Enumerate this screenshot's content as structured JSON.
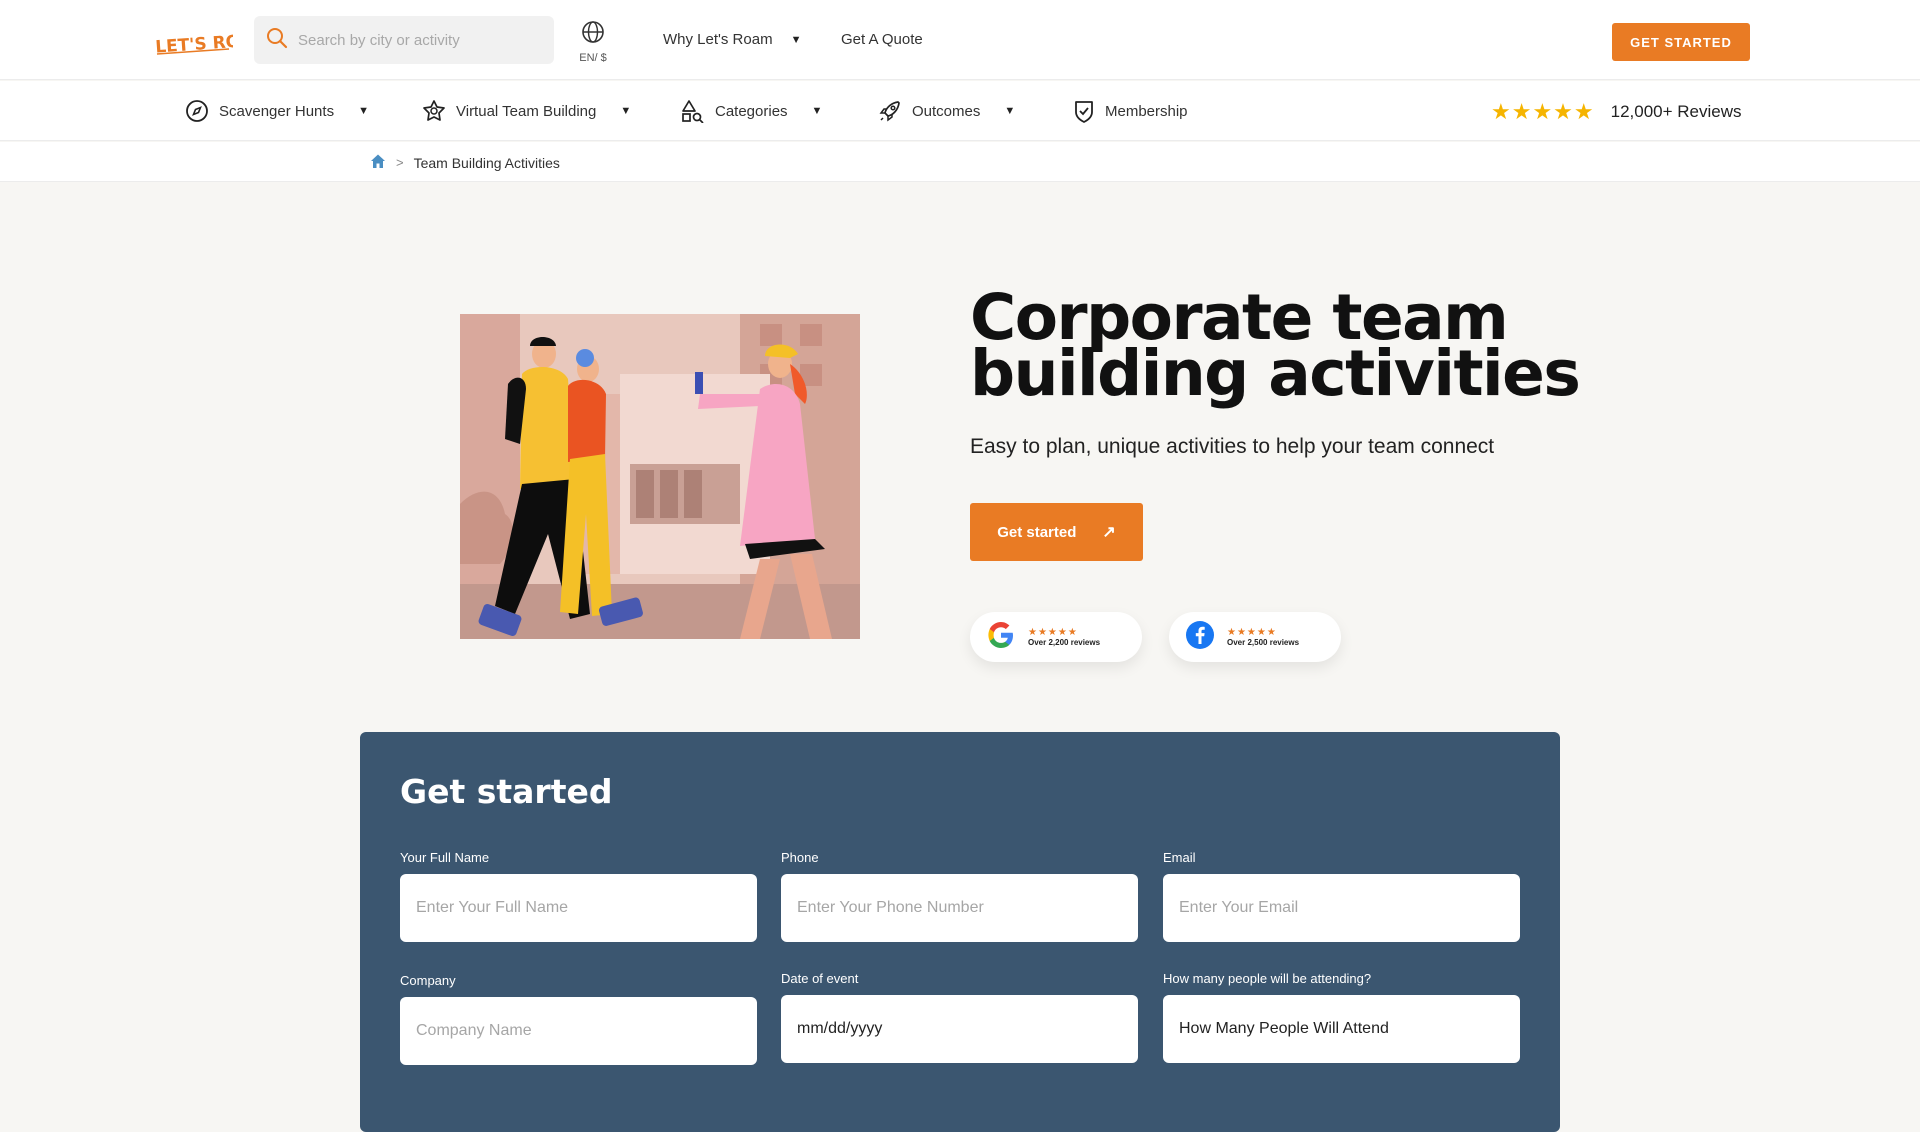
{
  "header": {
    "logo_text": "LET'S ROAM",
    "search_placeholder": "Search by city or activity",
    "lang_label": "EN/ $",
    "why_label": "Why Let's Roam",
    "quote_label": "Get A Quote",
    "cta_label": "GET STARTED"
  },
  "nav": {
    "items": [
      {
        "label": "Scavenger Hunts"
      },
      {
        "label": "Virtual Team Building"
      },
      {
        "label": "Categories"
      },
      {
        "label": "Outcomes"
      },
      {
        "label": "Membership"
      }
    ],
    "reviews_label": "12,000+ Reviews",
    "rating_stars": 5
  },
  "breadcrumb": {
    "current": "Team Building Activities"
  },
  "hero": {
    "title_line1": "Corporate team",
    "title_line2": "building activities",
    "subtitle": "Easy to plan, unique activities to help your team connect",
    "cta_label": "Get started",
    "badges": [
      {
        "source": "Google",
        "stars": "★★★★★",
        "reviews": "Over 2,200 reviews"
      },
      {
        "source": "Facebook",
        "stars": "★★★★★",
        "reviews": "Over 2,500 reviews"
      }
    ]
  },
  "form": {
    "title": "Get started",
    "fields": [
      {
        "label": "Your Full Name",
        "placeholder": "Enter Your Full Name"
      },
      {
        "label": "Phone",
        "placeholder": "Enter Your Phone Number"
      },
      {
        "label": "Email",
        "placeholder": "Enter Your Email"
      },
      {
        "label": "Company",
        "placeholder": "Company Name"
      },
      {
        "label": "Date of event",
        "placeholder": "mm/dd/yyyy"
      },
      {
        "label": "How many people will be attending?",
        "placeholder": "How Many People Will Attend"
      }
    ]
  },
  "colors": {
    "accent": "#e97b24",
    "form_bg": "#3b5670",
    "page_bg": "#f7f6f3",
    "star": "#f5b400"
  }
}
